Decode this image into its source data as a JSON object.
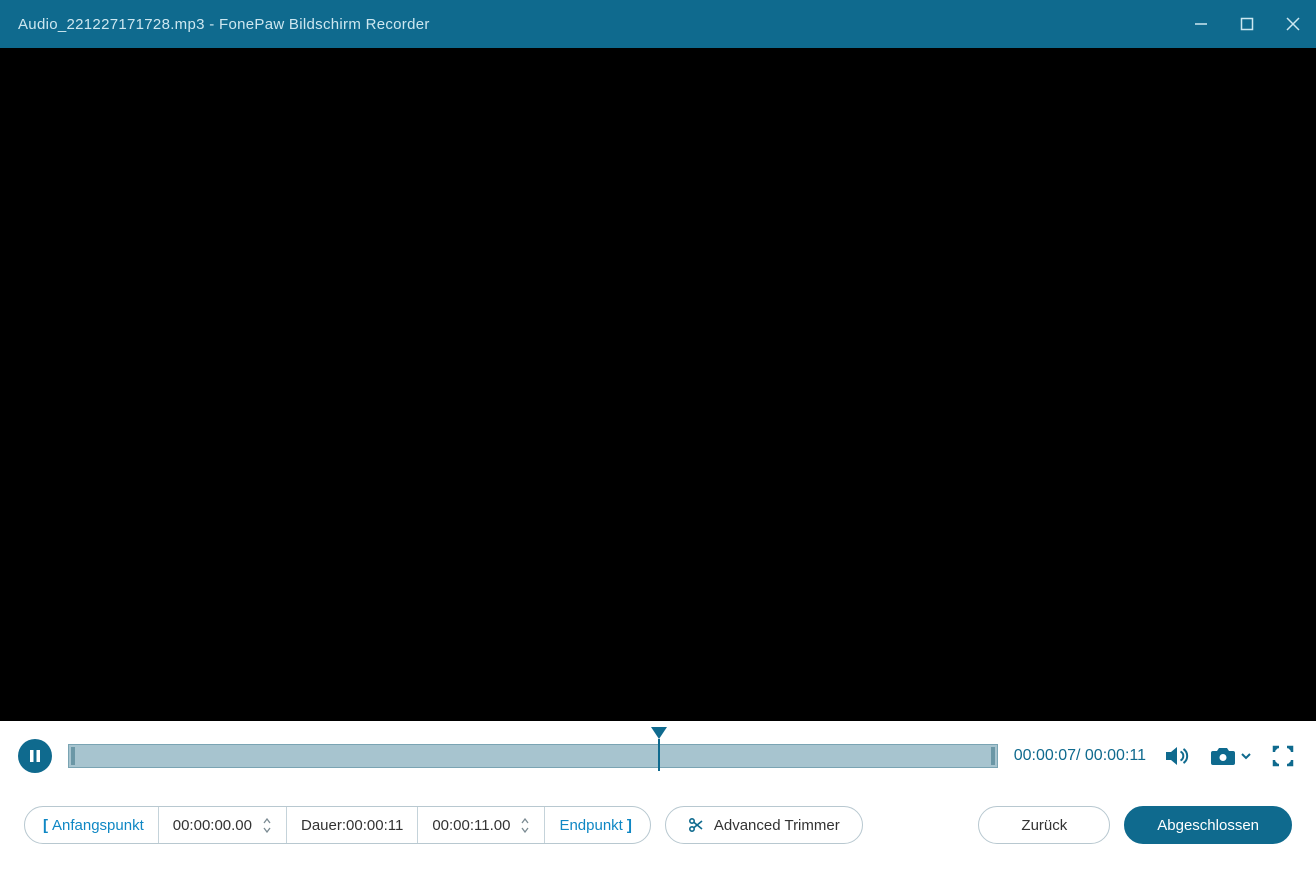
{
  "titlebar": {
    "filename": "Audio_221227171728.mp3",
    "separator": "  -  ",
    "app_name": "FonePaw Bildschirm Recorder"
  },
  "playback": {
    "current_time": "00:00:07",
    "total_time": "00:00:11",
    "time_separator": "/ ",
    "progress_percent": 63.6
  },
  "trim": {
    "start_label": "Anfangspunkt",
    "start_time": "00:00:00.00",
    "duration_label": "Dauer:",
    "duration_value": "00:00:11",
    "end_time": "00:00:11.00",
    "end_label": "Endpunkt"
  },
  "buttons": {
    "advanced_trimmer": "Advanced Trimmer",
    "back": "Zurück",
    "done": "Abgeschlossen"
  },
  "icons": {
    "minimize": "minimize-icon",
    "maximize": "maximize-icon",
    "close": "close-icon",
    "pause": "pause-icon",
    "volume": "volume-icon",
    "camera": "camera-icon",
    "chevron_down": "chevron-down-icon",
    "fullscreen": "fullscreen-icon",
    "scissors": "scissors-icon",
    "spin_up": "spin-up-icon",
    "spin_down": "spin-down-icon"
  },
  "colors": {
    "accent": "#0f6a8e",
    "track": "#a7c4cf",
    "link": "#0f87c4"
  }
}
